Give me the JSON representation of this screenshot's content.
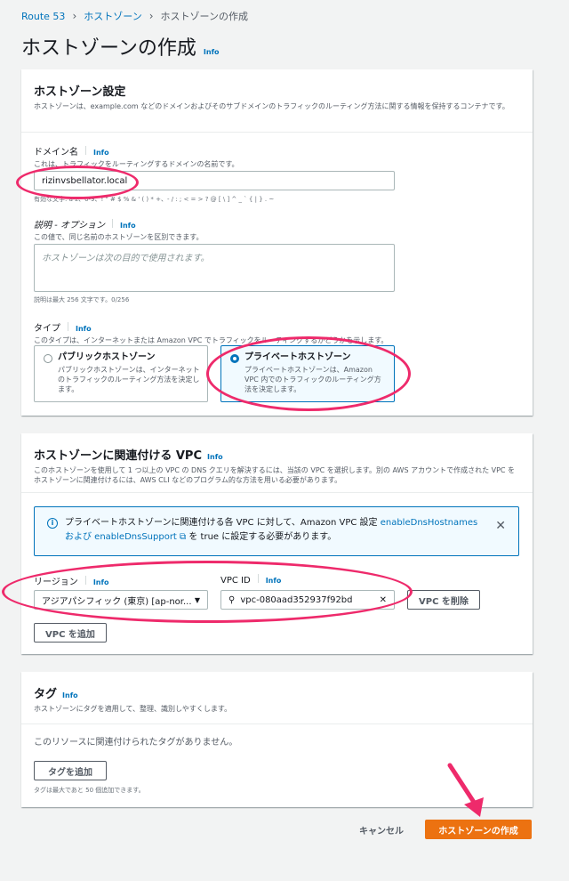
{
  "breadcrumb": {
    "items": [
      "Route 53",
      "ホストゾーン"
    ],
    "current": "ホストゾーンの作成"
  },
  "page": {
    "title": "ホストゾーンの作成",
    "info": "Info"
  },
  "settings": {
    "title": "ホストゾーン設定",
    "desc": "ホストゾーンは、example.com などのドメインおよびそのサブドメインのトラフィックのルーティング方法に関する情報を保持するコンテナです。",
    "domain": {
      "label": "ドメイン名",
      "info": "Info",
      "desc": "これは、トラフィックをルーティングするドメインの名前です。",
      "value": "rizinvsbellator.local",
      "hint": "有効な文字: a-z、0-9、! \" # $ % & ' ( ) * +、- / : ; < = > ? @ [ \\ ] ^ _ ` { | } . ~"
    },
    "description": {
      "label": "説明 - オプション",
      "info": "Info",
      "desc": "この値で、同じ名前のホストゾーンを区別できます。",
      "placeholder": "ホストゾーンは次の目的で使用されます。",
      "hint": "説明は最大 256 文字です。0/256"
    },
    "type": {
      "label": "タイプ",
      "info": "Info",
      "desc": "このタイプは、インターネットまたは Amazon VPC でトラフィックをルーティングするかどうかを示します。",
      "public_title": "パブリックホストゾーン",
      "public_desc": "パブリックホストゾーンは、インターネットのトラフィックのルーティング方法を決定します。",
      "private_title": "プライベートホストゾーン",
      "private_desc": "プライベートホストゾーンは、Amazon VPC 内でのトラフィックのルーティング方法を決定します。"
    }
  },
  "vpc": {
    "title": "ホストゾーンに関連付ける VPC",
    "info": "Info",
    "desc": "このホストゾーンを使用して 1 つ以上の VPC の DNS クエリを解決するには、当該の VPC を選択します。別の AWS アカウントで作成された VPC をホストゾーンに関連付けるには、AWS CLI などのプログラム的な方法を用いる必要があります。",
    "alert_pre": "プライベートホストゾーンに関連付ける各 VPC に対して、Amazon VPC 設定 ",
    "alert_link1": "enableDnsHostnames および enableDnsSupport",
    "alert_post": " を true に設定する必要があります。",
    "region_label": "リージョン",
    "region_info": "Info",
    "region_value": "アジアパシフィック (東京) [ap-nor...",
    "vpcid_label": "VPC ID",
    "vpcid_info": "Info",
    "vpcid_value": "vpc-080aad352937f92bd",
    "remove_label": "VPC を削除",
    "add_label": "VPC を追加"
  },
  "tags": {
    "title": "タグ",
    "info": "Info",
    "desc": "ホストゾーンにタグを適用して、整理、識別しやすくします。",
    "empty": "このリソースに関連付けられたタグがありません。",
    "add_label": "タグを追加",
    "hint": "タグは最大であと 50 個追加できます。"
  },
  "footer": {
    "cancel": "キャンセル",
    "create": "ホストゾーンの作成"
  },
  "colors": {
    "accent": "#ec7211",
    "link": "#0073bb",
    "annotation": "#ee2a6b"
  }
}
